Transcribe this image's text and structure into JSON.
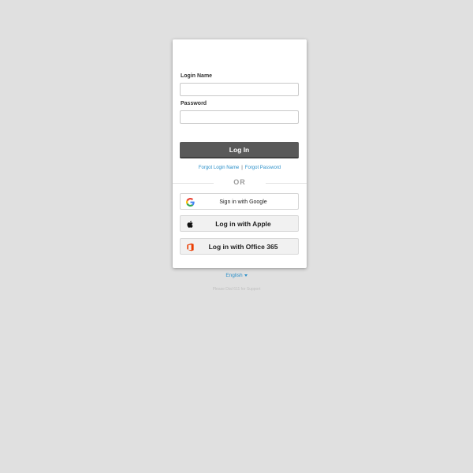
{
  "form": {
    "login_name_label": "Login Name",
    "login_name_value": "",
    "password_label": "Password",
    "password_value": "",
    "login_button": "Log In"
  },
  "links": {
    "forgot_login_name": "Forgot Login Name",
    "separator": "|",
    "forgot_password": "Forgot Password"
  },
  "divider": {
    "text": "OR"
  },
  "sso": {
    "google": {
      "label": "Sign in with Google",
      "icon": "google-g-icon"
    },
    "apple": {
      "label": "Log in with Apple",
      "icon": "apple-icon"
    },
    "office": {
      "label": "Log in with Office 365",
      "icon": "office-icon"
    }
  },
  "footer": {
    "language": "English",
    "support": "Please Dial 611 for Support"
  },
  "colors": {
    "background": "#e0e0e0",
    "primary_button": "#595959",
    "link": "#2a8fc9",
    "office_orange": "#eb3c00"
  }
}
